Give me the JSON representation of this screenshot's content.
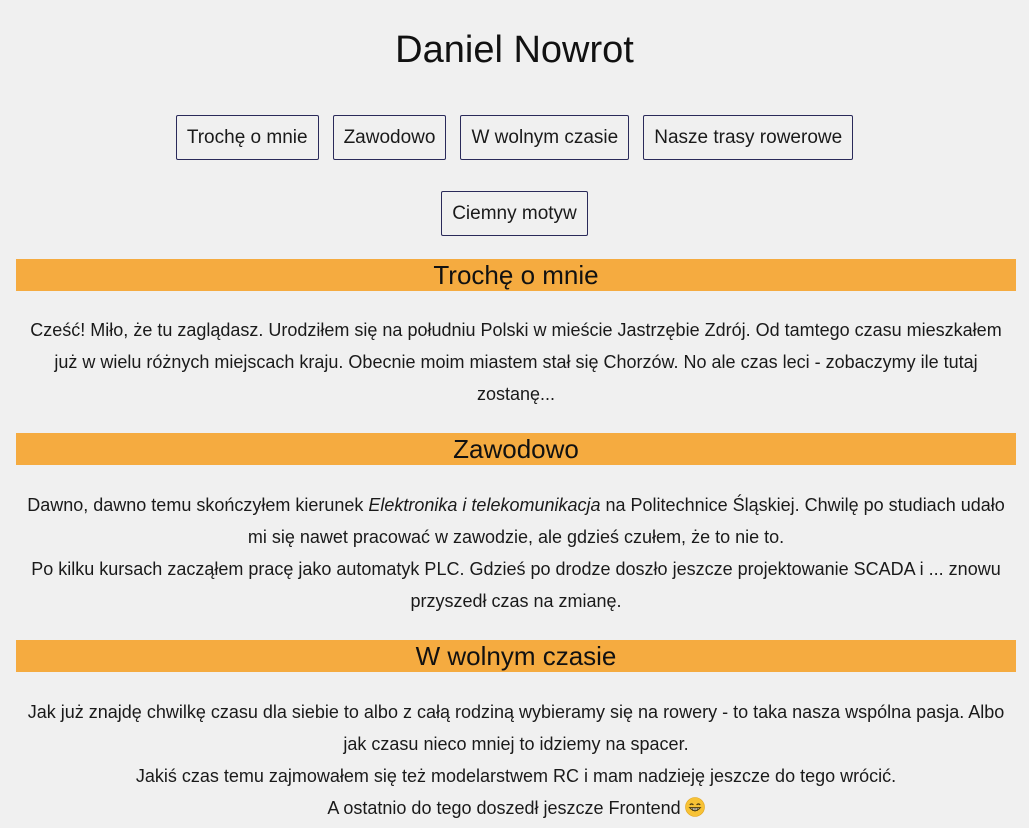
{
  "site": {
    "title": "Daniel Nowrot"
  },
  "nav": {
    "items": [
      {
        "label": "Trochę o mnie"
      },
      {
        "label": "Zawodowo"
      },
      {
        "label": "W wolnym czasie"
      },
      {
        "label": "Nasze trasy rowerowe"
      }
    ],
    "theme_toggle_label": "Ciemny motyw"
  },
  "sections": {
    "about": {
      "heading": "Trochę o mnie",
      "text": "Cześć! Miło, że tu zaglądasz. Urodziłem się na południu Polski w mieście Jastrzębie Zdrój. Od tamtego czasu mieszkałem już w wielu różnych miejscach kraju. Obecnie moim miastem stał się Chorzów. No ale czas leci - zobaczymy ile tutaj zostanę..."
    },
    "work": {
      "heading": "Zawodowo",
      "p1_before": "Dawno, dawno temu skończyłem kierunek ",
      "p1_em": "Elektronika i telekomunikacja",
      "p1_after": " na Politechnice Śląskiej. Chwilę po studiach udało mi się nawet pracować w zawodzie, ale gdzieś czułem, że to nie to.",
      "p2": "Po kilku kursach zacząłem pracę jako automatyk PLC. Gdzieś po drodze doszło jeszcze projektowanie SCADA i ... znowu przyszedł czas na zmianę."
    },
    "free_time": {
      "heading": "W wolnym czasie",
      "p1": "Jak już znajdę chwilkę czasu dla siebie to albo z całą rodziną wybieramy się na rowery - to taka nasza wspólna pasja. Albo jak czasu nieco mniej to idziemy na spacer.",
      "p2": "Jakiś czas temu zajmowałem się też modelarstwem RC i mam nadzieję jeszcze do tego wrócić.",
      "p3": "A ostatnio do tego doszedł jeszcze Frontend",
      "p3_icon": "grinning-face-emoji-icon"
    }
  },
  "colors": {
    "background": "#f0f0f0",
    "section_header": "#f5ab40",
    "button_border": "#2a2a5a"
  }
}
